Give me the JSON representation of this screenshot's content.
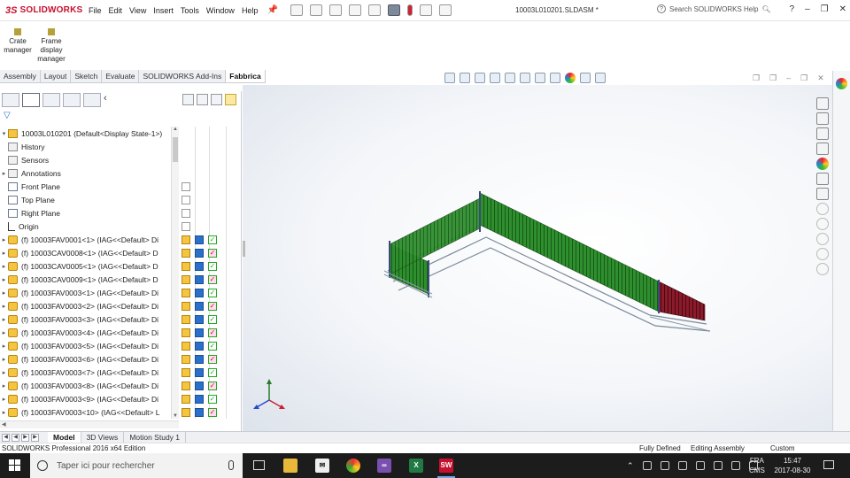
{
  "app": {
    "brand": "SOLIDWORKS",
    "document_title": "10003L010201.SLDASM *",
    "help_search_placeholder": "Search SOLIDWORKS Help",
    "menu": [
      "File",
      "Edit",
      "View",
      "Insert",
      "Tools",
      "Window",
      "Help"
    ]
  },
  "command_manager": {
    "buttons": [
      {
        "label": "Crate manager"
      },
      {
        "label": "Frame display manager"
      }
    ],
    "tabs": [
      "Assembly",
      "Layout",
      "Sketch",
      "Evaluate",
      "SOLIDWORKS Add-Ins",
      "Fabbrica"
    ],
    "active_tab": "Fabbrica"
  },
  "feature_tree": {
    "root": "10003L010201  (Default<Display State-1>)",
    "items": [
      {
        "label": "History",
        "icon": "history-icon",
        "expandable": false
      },
      {
        "label": "Sensors",
        "icon": "sensors-icon",
        "expandable": false
      },
      {
        "label": "Annotations",
        "icon": "annotations-icon",
        "expandable": true
      },
      {
        "label": "Front Plane",
        "icon": "plane-icon",
        "expandable": false
      },
      {
        "label": "Top Plane",
        "icon": "plane-icon",
        "expandable": false
      },
      {
        "label": "Right Plane",
        "icon": "plane-icon",
        "expandable": false
      },
      {
        "label": "Origin",
        "icon": "origin-icon",
        "expandable": false
      },
      {
        "label": "(f) 10003FAV0001<1> (IAG<<Default> Di",
        "icon": "part-icon",
        "expandable": true
      },
      {
        "label": "(f) 10003CAV0008<1> (IAG<<Default> D",
        "icon": "part-icon",
        "expandable": true
      },
      {
        "label": "(f) 10003CAV0005<1> (IAG<<Default> D",
        "icon": "part-icon",
        "expandable": true
      },
      {
        "label": "(f) 10003CAV0009<1> (IAG<<Default> D",
        "icon": "part-icon",
        "expandable": true
      },
      {
        "label": "(f) 10003FAV0003<1> (IAG<<Default> Di",
        "icon": "part-icon",
        "expandable": true
      },
      {
        "label": "(f) 10003FAV0003<2> (IAG<<Default> Di",
        "icon": "part-icon",
        "expandable": true
      },
      {
        "label": "(f) 10003FAV0003<3> (IAG<<Default> Di",
        "icon": "part-icon",
        "expandable": true
      },
      {
        "label": "(f) 10003FAV0003<4> (IAG<<Default> Di",
        "icon": "part-icon",
        "expandable": true
      },
      {
        "label": "(f) 10003FAV0003<5> (IAG<<Default> Di",
        "icon": "part-icon",
        "expandable": true
      },
      {
        "label": "(f) 10003FAV0003<6> (IAG<<Default> Di",
        "icon": "part-icon",
        "expandable": true
      },
      {
        "label": "(f) 10003FAV0003<7> (IAG<<Default> Di",
        "icon": "part-icon",
        "expandable": true
      },
      {
        "label": "(f) 10003FAV0003<8> (IAG<<Default> Di",
        "icon": "part-icon",
        "expandable": true
      },
      {
        "label": "(f) 10003FAV0003<9> (IAG<<Default> Di",
        "icon": "part-icon",
        "expandable": true
      },
      {
        "label": "(f) 10003FAV0003<10> (IAG<<Default> L",
        "icon": "part-icon",
        "expandable": true
      }
    ]
  },
  "bottom_tabs": [
    "Model",
    "3D Views",
    "Motion Study 1"
  ],
  "active_bottom_tab": "Model",
  "status": {
    "edition": "SOLIDWORKS Professional 2016 x64 Edition",
    "definition": "Fully Defined",
    "mode": "Editing Assembly",
    "units": "Custom"
  },
  "taskbar": {
    "search_placeholder": "Taper ici pour rechercher",
    "lang_top": "FRA",
    "lang_bottom": "CMS",
    "time": "15:47",
    "date": "2017-08-30"
  },
  "colors": {
    "brand_red": "#c8102e",
    "model_green": "#2e8b2e",
    "model_red": "#8b1a2a",
    "model_steel": "#7a8899"
  }
}
